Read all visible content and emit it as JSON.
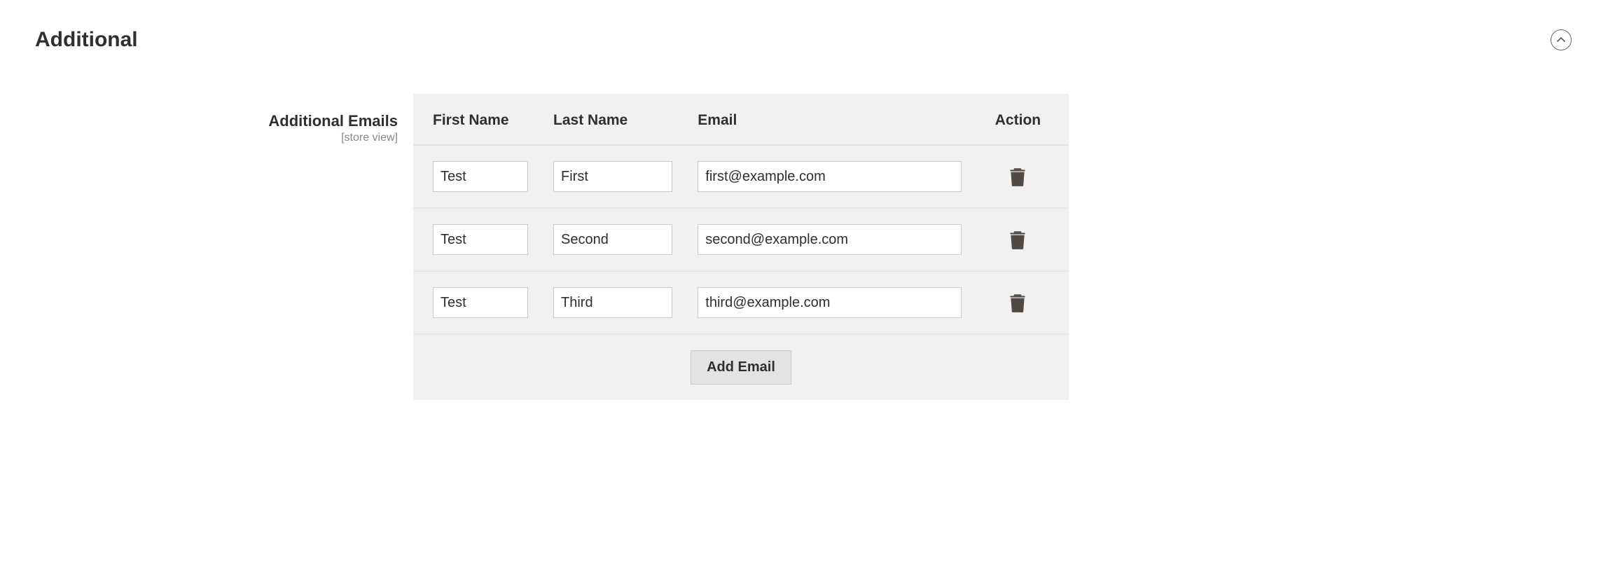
{
  "section": {
    "title": "Additional"
  },
  "field": {
    "label": "Additional Emails",
    "scope": "[store view]"
  },
  "table": {
    "headers": {
      "first_name": "First Name",
      "last_name": "Last Name",
      "email": "Email",
      "action": "Action"
    },
    "rows": [
      {
        "first_name": "Test",
        "last_name": "First",
        "email": "first@example.com"
      },
      {
        "first_name": "Test",
        "last_name": "Second",
        "email": "second@example.com"
      },
      {
        "first_name": "Test",
        "last_name": "Third",
        "email": "third@example.com"
      }
    ],
    "add_button": "Add Email"
  },
  "icons": {
    "delete": "trash-icon",
    "collapse": "chevron-up-icon"
  }
}
